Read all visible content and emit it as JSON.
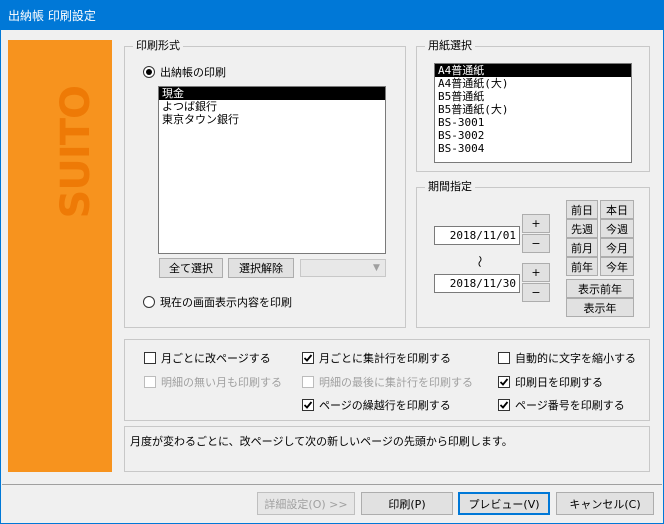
{
  "window": {
    "title": "出納帳 印刷設定"
  },
  "banner": {
    "logo_text": "SUITO"
  },
  "print_format": {
    "legend": "印刷形式",
    "radio_ledger": "出納帳の印刷",
    "accounts": [
      "現金",
      "よつば銀行",
      "東京タウン銀行"
    ],
    "select_all": "全て選択",
    "deselect": "選択解除",
    "radio_screen": "現在の画面表示内容を印刷"
  },
  "paper": {
    "legend": "用紙選択",
    "items": [
      "A4普通紙",
      "A4普通紙(大)",
      "B5普通紙",
      "B5普通紙(大)",
      "BS-3001",
      "BS-3002",
      "BS-3004"
    ]
  },
  "period": {
    "legend": "期間指定",
    "start_date": "2018/11/01",
    "end_date": "2018/11/30",
    "tilde": "～",
    "plus": "+",
    "minus": "−",
    "prev_day": "前日",
    "today": "本日",
    "prev_week": "先週",
    "this_week": "今週",
    "prev_month": "前月",
    "this_month": "今月",
    "prev_year": "前年",
    "this_year": "今年",
    "show_prev_year": "表示前年",
    "show_year": "表示年"
  },
  "options": {
    "page_break_monthly": "月ごとに改ページする",
    "print_monthly_totals": "月ごとに集計行を印刷する",
    "shrink_text": "自動的に文字を縮小する",
    "print_empty_months": "明細の無い月も印刷する",
    "print_final_totals": "明細の最後に集計行を印刷する",
    "print_date": "印刷日を印刷する",
    "print_carryover": "ページの繰越行を印刷する",
    "print_page_number": "ページ番号を印刷する"
  },
  "description": "月度が変わるごとに、改ページして次の新しいページの先頭から印刷します。",
  "footer": {
    "details": "詳細設定(O) >>",
    "print": "印刷(P)",
    "preview": "プレビュー(V)",
    "cancel": "キャンセル(C)"
  }
}
